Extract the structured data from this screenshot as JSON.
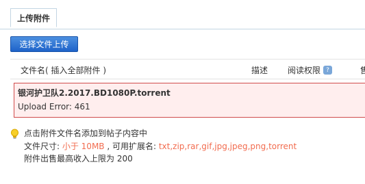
{
  "tabs": {
    "upload_attachment": "上传附件"
  },
  "toolbar": {
    "select_file_upload": "选择文件上传"
  },
  "list_header": {
    "filename": "文件名",
    "insert_all_prefix": "( ",
    "insert_all": "插入全部附件",
    "insert_all_suffix": " )",
    "description": "描述",
    "read_permission": "阅读权限",
    "help_icon": "?",
    "more": "售"
  },
  "error": {
    "filename": "银河护卫队2.2017.BD1080P.torrent",
    "message": "Upload Error: 461"
  },
  "tips": {
    "icon": "lightbulb-icon",
    "click_hint": "点击附件文件名添加到帖子内容中",
    "size_label": "文件尺寸: ",
    "size_limit": "小于 10MB",
    "ext_label": " , 可用扩展名: ",
    "extensions": "txt,zip,rar,gif,jpg,jpeg,png,torrent",
    "sale_limit": "附件出售最高收入上限为 200"
  },
  "colors": {
    "accent": "#1e63c9",
    "error_bg": "#ffeeee",
    "error_border": "#d04a4a",
    "highlight": "#f26c4f"
  }
}
